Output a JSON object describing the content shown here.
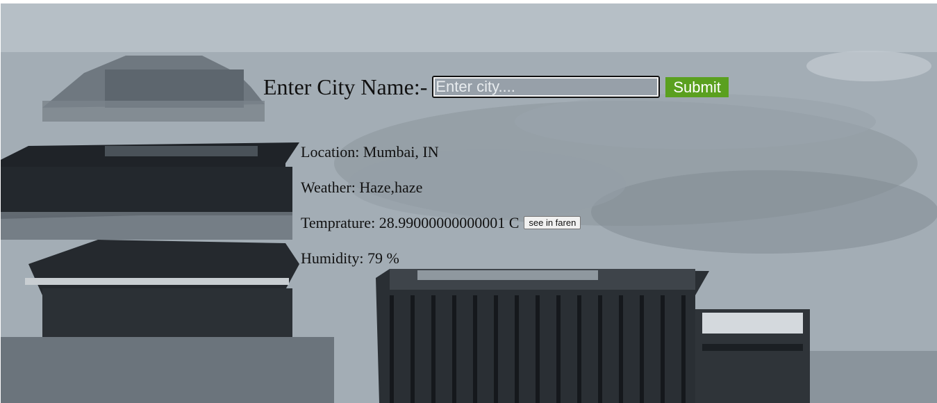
{
  "search": {
    "label": "Enter City Name:-",
    "placeholder": "Enter city....",
    "value": "",
    "submit_label": "Submit"
  },
  "results": {
    "location_label": "Location:",
    "location_value": "Mumbai, IN",
    "weather_label": "Weather:",
    "weather_value": "Haze,haze",
    "temperature_label": "Temprature:",
    "temperature_value": "28.99000000000001 C",
    "faren_button": "see in faren",
    "humidity_label": "Humidity:",
    "humidity_value": "79 %"
  },
  "colors": {
    "submit": "#5aa01f",
    "text": "#111111"
  }
}
